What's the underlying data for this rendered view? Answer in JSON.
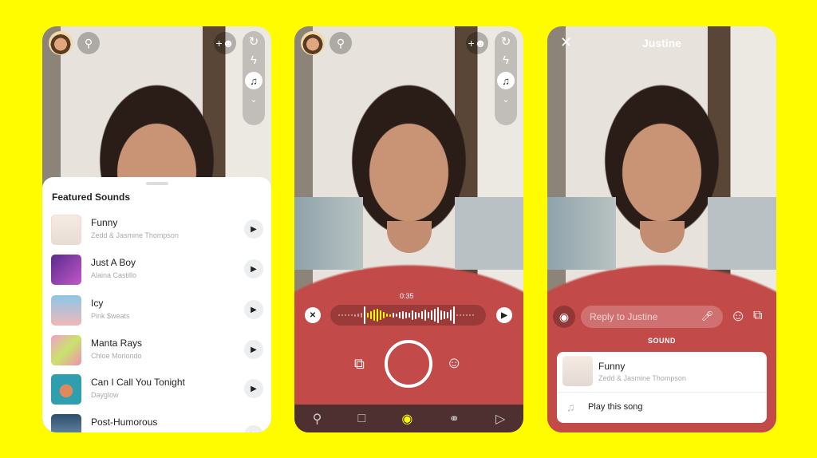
{
  "colors": {
    "brand": "#FFFC00",
    "capture_active": "#FFFC00"
  },
  "panel1": {
    "sheet_title": "Featured Sounds",
    "songs": [
      {
        "title": "Funny",
        "artist": "Zedd & Jasmine Thompson"
      },
      {
        "title": "Just A Boy",
        "artist": "Alaina Castillo"
      },
      {
        "title": "Icy",
        "artist": "Pink $weats"
      },
      {
        "title": "Manta Rays",
        "artist": "Chloe Moriondo"
      },
      {
        "title": "Can I Call You Tonight",
        "artist": "Dayglow"
      },
      {
        "title": "Post-Humorous",
        "artist": ""
      }
    ]
  },
  "panel2": {
    "timestamp": "0:35"
  },
  "panel3": {
    "title": "Justine",
    "reply_placeholder": "Reply to Justine",
    "section_label": "SOUND",
    "song_title": "Funny",
    "song_artist": "Zedd & Jasmine Thompson",
    "play_label": "Play this song"
  }
}
